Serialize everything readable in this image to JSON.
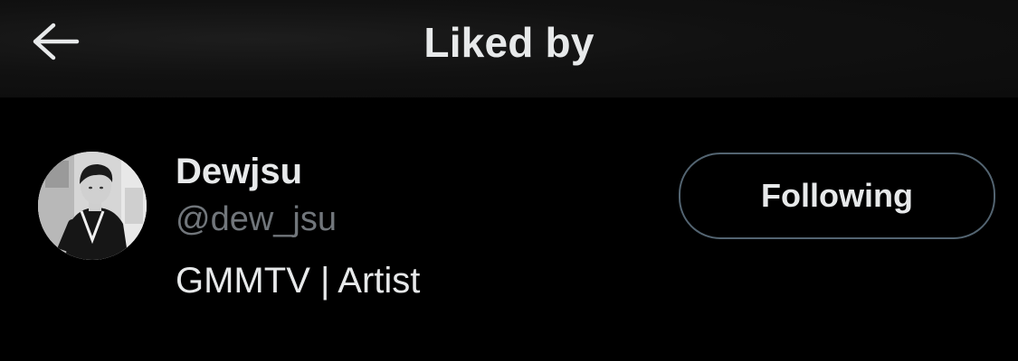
{
  "header": {
    "title": "Liked by",
    "back_icon": "arrow-left-icon"
  },
  "users": [
    {
      "name": "Dewjsu",
      "handle": "@dew_jsu",
      "bio": "GMMTV | Artist",
      "follow_label": "Following",
      "avatar": "avatar-photo"
    }
  ],
  "colors": {
    "background": "#000000",
    "header_background": "#111111",
    "primary_text": "#e7e9ea",
    "secondary_text": "#71767b",
    "button_border": "#536471"
  }
}
